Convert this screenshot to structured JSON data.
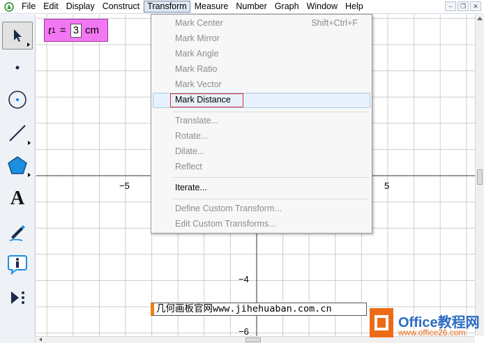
{
  "menubar": {
    "items": [
      "File",
      "Edit",
      "Display",
      "Construct",
      "Transform",
      "Measure",
      "Number",
      "Graph",
      "Window",
      "Help"
    ],
    "active": "Transform",
    "window_buttons": [
      "minimize",
      "restore",
      "close"
    ]
  },
  "toolbox": {
    "tools": [
      "arrow-select-tool",
      "point-tool",
      "compass-tool",
      "straightedge-tool",
      "polygon-tool",
      "text-tool",
      "marker-tool",
      "information-tool",
      "custom-tool"
    ],
    "text_tool_glyph": "A"
  },
  "canvas": {
    "x_tick_labels": [
      "−5",
      "5"
    ],
    "y_tick_labels": [
      "−4",
      "−6"
    ]
  },
  "parameter": {
    "name": "t",
    "subscript": "1",
    "equals": "=",
    "value": "3",
    "unit": "cm"
  },
  "caption": {
    "text": "几何画板官网www.jihehuaban.com.cn"
  },
  "transform_menu": {
    "items": [
      {
        "label": "Mark Center",
        "shortcut": "Shift+Ctrl+F",
        "enabled": false
      },
      {
        "label": "Mark Mirror",
        "enabled": false
      },
      {
        "label": "Mark Angle",
        "enabled": false
      },
      {
        "label": "Mark Ratio",
        "enabled": false
      },
      {
        "label": "Mark Vector",
        "enabled": false
      },
      {
        "label": "Mark Distance",
        "enabled": true,
        "highlighted": true
      },
      {
        "label": "Translate...",
        "enabled": false
      },
      {
        "label": "Rotate...",
        "enabled": false
      },
      {
        "label": "Dilate...",
        "enabled": false
      },
      {
        "label": "Reflect",
        "enabled": false
      },
      {
        "label": "Iterate...",
        "enabled": true
      },
      {
        "label": "Define Custom Transform...",
        "enabled": false
      },
      {
        "label": "Edit Custom Transforms...",
        "enabled": false
      }
    ]
  },
  "watermark": {
    "brand": "Office教程网",
    "url": "www.office26.com"
  },
  "colors": {
    "parameter_fill": "#f277f2",
    "caption_accent": "#ef7f1a",
    "menu_highlight": "#e7f1fb",
    "red_marker": "#e03030",
    "grid": "#cccccc"
  }
}
